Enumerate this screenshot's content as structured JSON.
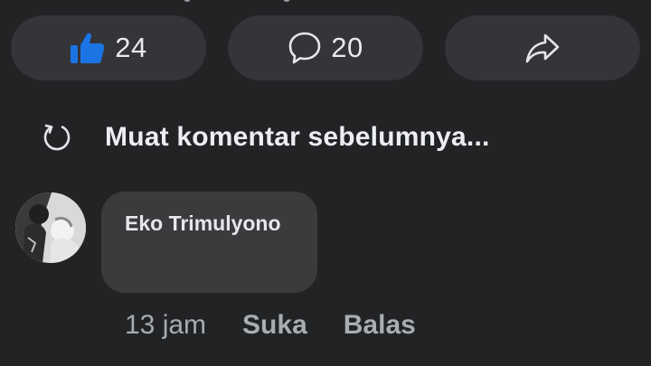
{
  "actions": {
    "like_count": "24",
    "comment_count": "20"
  },
  "load_more": {
    "label": "Muat komentar sebelumnya..."
  },
  "comment": {
    "author": "Eko Trimulyono",
    "time": "13 jam",
    "like_label": "Suka",
    "reply_label": "Balas"
  },
  "colors": {
    "background": "#222325",
    "button_bg": "#343538",
    "bubble_bg": "#3a3b3d",
    "like_blue": "#1b74e4",
    "meta_text": "#a9acb0"
  },
  "icons": {
    "like": "thumbs-up-icon",
    "comment": "speech-bubble-icon",
    "share": "share-arrow-icon",
    "load_more": "refresh-icon"
  }
}
